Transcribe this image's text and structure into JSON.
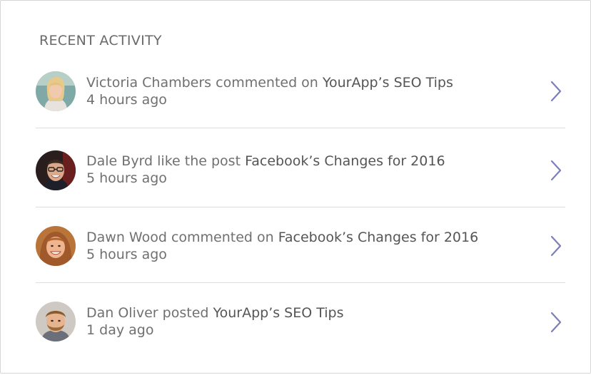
{
  "section": {
    "title": "RECENT ACTIVITY"
  },
  "colors": {
    "chevron": "#7b7fb8",
    "divider": "#dedede",
    "text": "#707070"
  },
  "activities": [
    {
      "actor": "Victoria Chambers",
      "action": "commented on",
      "target": "YourApp’s SEO Tips",
      "time": "4 hours ago",
      "avatar": "avatar-victoria-chambers",
      "icon": "chevron-right-icon"
    },
    {
      "actor": "Dale Byrd",
      "action": "like the post",
      "target": "Facebook’s Changes for 2016",
      "time": "5 hours ago",
      "avatar": "avatar-dale-byrd",
      "icon": "chevron-right-icon"
    },
    {
      "actor": "Dawn Wood",
      "action": "commented on",
      "target": "Facebook’s Changes for 2016",
      "time": "5 hours ago",
      "avatar": "avatar-dawn-wood",
      "icon": "chevron-right-icon"
    },
    {
      "actor": "Dan Oliver",
      "action": "posted",
      "target": "YourApp’s SEO Tips",
      "time": "1 day ago",
      "avatar": "avatar-dan-oliver",
      "icon": "chevron-right-icon"
    }
  ]
}
